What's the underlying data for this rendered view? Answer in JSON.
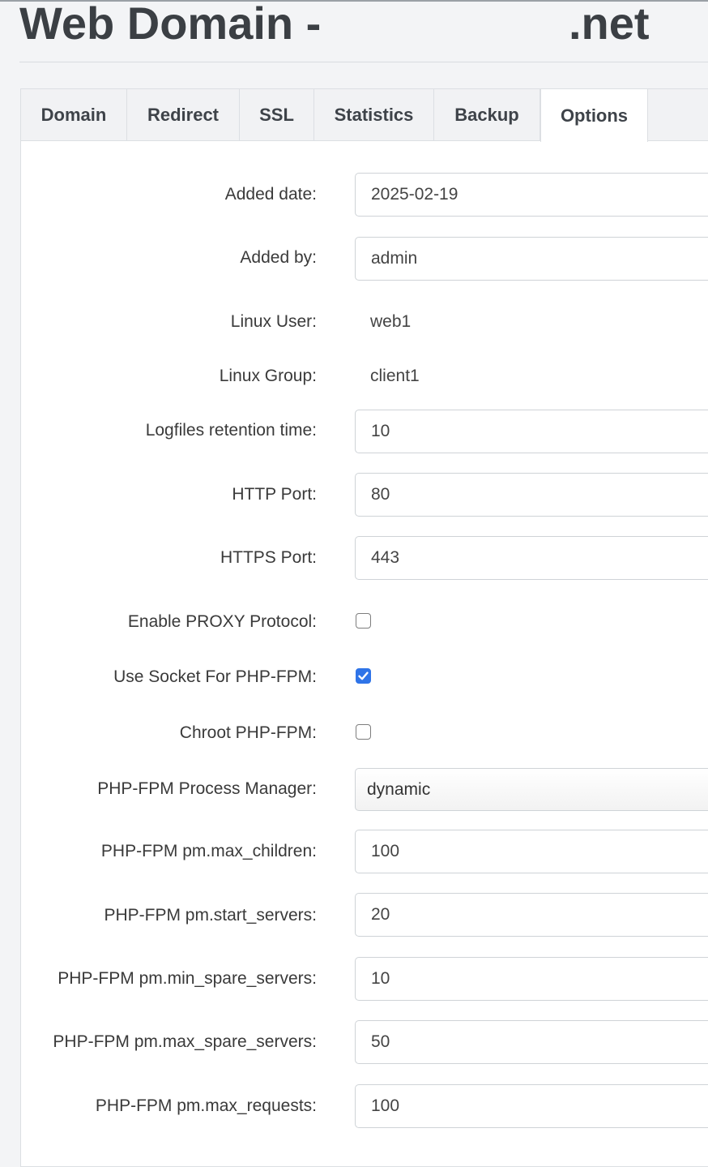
{
  "page": {
    "title": "Web Domain -",
    "title_suffix": ".net"
  },
  "tabs": [
    {
      "label": "Domain",
      "active": false
    },
    {
      "label": "Redirect",
      "active": false
    },
    {
      "label": "SSL",
      "active": false
    },
    {
      "label": "Statistics",
      "active": false
    },
    {
      "label": "Backup",
      "active": false
    },
    {
      "label": "Options",
      "active": true
    }
  ],
  "form": {
    "added_date": {
      "label": "Added date:",
      "value": "2025-02-19"
    },
    "added_by": {
      "label": "Added by:",
      "value": "admin"
    },
    "linux_user": {
      "label": "Linux User:",
      "value": "web1"
    },
    "linux_group": {
      "label": "Linux Group:",
      "value": "client1"
    },
    "log_retention": {
      "label": "Logfiles retention time:",
      "value": "10"
    },
    "http_port": {
      "label": "HTTP Port:",
      "value": "80"
    },
    "https_port": {
      "label": "HTTPS Port:",
      "value": "443"
    },
    "proxy_protocol": {
      "label": "Enable PROXY Protocol:",
      "checked": false
    },
    "php_socket": {
      "label": "Use Socket For PHP-FPM:",
      "checked": true
    },
    "chroot_php": {
      "label": "Chroot PHP-FPM:",
      "checked": false
    },
    "pm": {
      "label": "PHP-FPM Process Manager:",
      "value": "dynamic"
    },
    "max_children": {
      "label": "PHP-FPM pm.max_children:",
      "value": "100"
    },
    "start_servers": {
      "label": "PHP-FPM pm.start_servers:",
      "value": "20"
    },
    "min_spare": {
      "label": "PHP-FPM pm.min_spare_servers:",
      "value": "10"
    },
    "max_spare": {
      "label": "PHP-FPM pm.max_spare_servers:",
      "value": "50"
    },
    "max_requests": {
      "label": "PHP-FPM pm.max_requests:",
      "value": "100"
    }
  },
  "colors": {
    "checkbox_checked": "#2f74e8",
    "panel_bg": "#ffffff",
    "page_bg": "#f3f4f6"
  }
}
